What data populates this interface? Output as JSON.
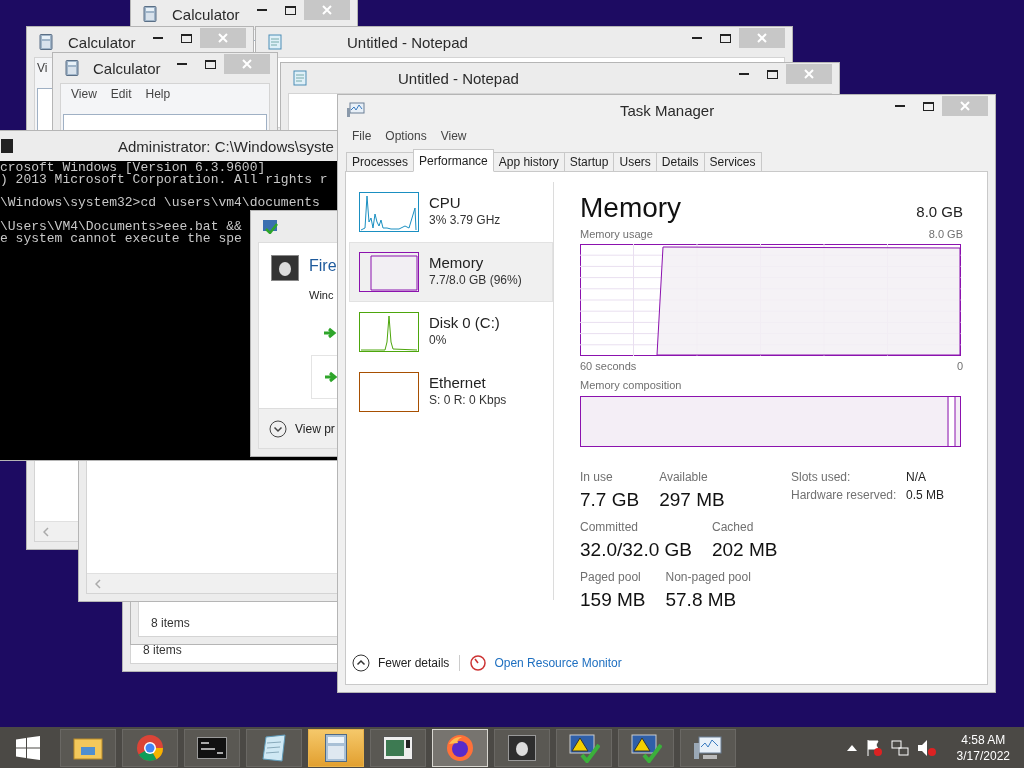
{
  "desktop_windows": [
    {
      "kind": "calculator",
      "title": "Calculator"
    },
    {
      "kind": "calculator",
      "title": "Calculator",
      "menu": [
        "Vi"
      ]
    },
    {
      "kind": "notepad",
      "title": "Untitled - Notepad"
    },
    {
      "kind": "calculator",
      "title": "Calculator",
      "menu": [
        "View",
        "Edit",
        "Help"
      ]
    },
    {
      "kind": "notepad",
      "title": "Untitled - Notepad"
    },
    {
      "kind": "explorer"
    },
    {
      "kind": "explorer"
    },
    {
      "kind": "explorer",
      "status": "8 items"
    },
    {
      "kind": "explorer",
      "status": "8 items"
    }
  ],
  "console": {
    "title": "Administrator: C:\\Windows\\syste",
    "blocks": [
      [
        "crosoft Windows [Version 6.3.9600]",
        ") 2013 Microsoft Corporation. All rights r"
      ],
      [
        "\\Windows\\system32>cd \\users\\vm4\\documents"
      ],
      [
        "\\Users\\VM4\\Documents>eee.bat &&",
        "e system cannot execute the spe"
      ]
    ]
  },
  "firewall_dialog": {
    "heading": "Fire",
    "text": "Winc",
    "footer": "View pr"
  },
  "task_manager": {
    "title": "Task Manager",
    "menu": [
      "File",
      "Options",
      "View"
    ],
    "tabs": [
      {
        "label": "Processes",
        "selected": false
      },
      {
        "label": "Performance",
        "selected": true
      },
      {
        "label": "App history",
        "selected": false
      },
      {
        "label": "Startup",
        "selected": false
      },
      {
        "label": "Users",
        "selected": false
      },
      {
        "label": "Details",
        "selected": false
      },
      {
        "label": "Services",
        "selected": false
      }
    ],
    "resources": [
      {
        "kind": "cpu",
        "name": "CPU",
        "detail": "3% 3.79 GHz",
        "color": "#1a8fc1",
        "selected": false
      },
      {
        "kind": "memory",
        "name": "Memory",
        "detail": "7.7/8.0 GB (96%)",
        "color": "#8b12ae",
        "selected": true
      },
      {
        "kind": "disk",
        "name": "Disk 0 (C:)",
        "detail": "0%",
        "color": "#4da60c",
        "selected": false
      },
      {
        "kind": "network",
        "name": "Ethernet",
        "detail": "S: 0 R: 0 Kbps",
        "color": "#a74f01",
        "selected": false
      }
    ],
    "detail": {
      "heading": "Memory",
      "total": "8.0 GB",
      "graph_label": "Memory usage",
      "graph_max": "8.0 GB",
      "time_span": "60 seconds",
      "time_end": "0",
      "composition_label": "Memory composition",
      "stats": [
        [
          {
            "label": "In use",
            "value": "7.7 GB"
          },
          {
            "label": "Available",
            "value": "297 MB"
          }
        ],
        [
          {
            "label": "Committed",
            "value": "32.0/32.0 GB"
          },
          {
            "label": "Cached",
            "value": "202 MB"
          }
        ],
        [
          {
            "label": "Paged pool",
            "value": "159 MB"
          },
          {
            "label": "Non-paged pool",
            "value": "57.8 MB"
          }
        ]
      ],
      "hardware": [
        {
          "label": "Slots used:",
          "value": "N/A"
        },
        {
          "label": "Hardware reserved:",
          "value": "0.5 MB"
        }
      ]
    },
    "footer": {
      "fewer": "Fewer details",
      "link": "Open Resource Monitor"
    }
  },
  "taskbar": {
    "apps": [
      {
        "kind": "folder",
        "selected": false,
        "flashing": false
      },
      {
        "kind": "chrome",
        "selected": false,
        "flashing": false
      },
      {
        "kind": "console",
        "selected": false,
        "flashing": false
      },
      {
        "kind": "notepad",
        "selected": false,
        "flashing": false
      },
      {
        "kind": "calculator",
        "selected": false,
        "flashing": true
      },
      {
        "kind": "viewer",
        "selected": false,
        "flashing": false
      },
      {
        "kind": "firefox",
        "selected": true,
        "flashing": false
      },
      {
        "kind": "firewall",
        "selected": false,
        "flashing": false
      },
      {
        "kind": "warning",
        "selected": false,
        "flashing": false
      },
      {
        "kind": "warning",
        "selected": false,
        "flashing": false
      },
      {
        "kind": "monitor",
        "selected": false,
        "flashing": false
      }
    ],
    "time": "4:58 AM",
    "date": "3/17/2022"
  }
}
